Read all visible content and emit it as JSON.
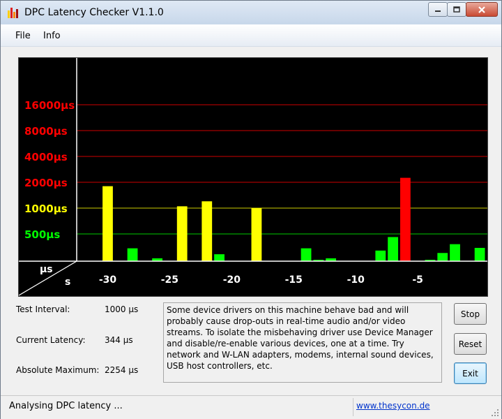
{
  "window": {
    "title": "DPC Latency Checker V1.1.0"
  },
  "menu": {
    "items": [
      "File",
      "Info"
    ]
  },
  "chart_data": {
    "type": "bar",
    "y_scale": "log",
    "x_unit": "s",
    "y_unit": "µs",
    "y_tick_labels": [
      {
        "label": "16000µs",
        "value": 16000,
        "color": "#ff0000"
      },
      {
        "label": "8000µs",
        "value": 8000,
        "color": "#ff0000"
      },
      {
        "label": "4000µs",
        "value": 4000,
        "color": "#ff0000"
      },
      {
        "label": "2000µs",
        "value": 2000,
        "color": "#ff0000"
      },
      {
        "label": "1000µs",
        "value": 1000,
        "color": "#ffff00"
      },
      {
        "label": "500µs",
        "value": 500,
        "color": "#00ff00"
      }
    ],
    "x_tick_labels": [
      "-30",
      "-25",
      "-20",
      "-15",
      "-10",
      "-5"
    ],
    "x_ticks": [
      -30,
      -25,
      -20,
      -15,
      -10,
      -5
    ],
    "x": [
      -32,
      -31,
      -30,
      -29,
      -28,
      -27,
      -26,
      -25,
      -24,
      -23,
      -22,
      -21,
      -20,
      -19,
      -18,
      -17,
      -16,
      -15,
      -14,
      -13,
      -12,
      -11,
      -10,
      -9,
      -8,
      -7,
      -6,
      -5,
      -4,
      -3,
      -2,
      -1,
      0
    ],
    "values": [
      230,
      240,
      1800,
      140,
      340,
      230,
      260,
      220,
      1050,
      240,
      1200,
      290,
      170,
      200,
      1000,
      150,
      210,
      200,
      340,
      250,
      260,
      200,
      160,
      230,
      320,
      460,
      2254,
      230,
      250,
      300,
      380,
      170,
      344
    ],
    "bar_colors": [
      "#00ff00",
      "#00ff00",
      "#ffff00",
      "#00ff00",
      "#00ff00",
      "#00ff00",
      "#00ff00",
      "#00ff00",
      "#ffff00",
      "#00ff00",
      "#ffff00",
      "#00ff00",
      "#00ff00",
      "#00ff00",
      "#ffff00",
      "#00ff00",
      "#00ff00",
      "#00ff00",
      "#00ff00",
      "#00ff00",
      "#00ff00",
      "#00ff00",
      "#00ff00",
      "#00ff00",
      "#00ff00",
      "#00ff00",
      "#ff0000",
      "#00ff00",
      "#00ff00",
      "#00ff00",
      "#00ff00",
      "#00ff00",
      "#00ff00"
    ],
    "gridline_colors": {
      "red": "#cc0000",
      "yellow": "#cccc00",
      "green": "#00cc00"
    }
  },
  "info": {
    "test_interval_label": "Test Interval:",
    "test_interval_value": "1000 µs",
    "current_latency_label": "Current Latency:",
    "current_latency_value": "344 µs",
    "absolute_max_label": "Absolute Maximum:",
    "absolute_max_value": "2254 µs"
  },
  "message": "Some device drivers on this machine behave bad and will probably cause drop-outs in real-time audio and/or video streams. To isolate the misbehaving driver use Device Manager and disable/re-enable various devices, one at a time. Try network and W-LAN adapters, modems, internal sound devices, USB host controllers, etc.",
  "buttons": {
    "stop": "Stop",
    "reset": "Reset",
    "exit": "Exit"
  },
  "status": {
    "text": "Analysing DPC latency ...",
    "link": "www.thesycon.de"
  }
}
